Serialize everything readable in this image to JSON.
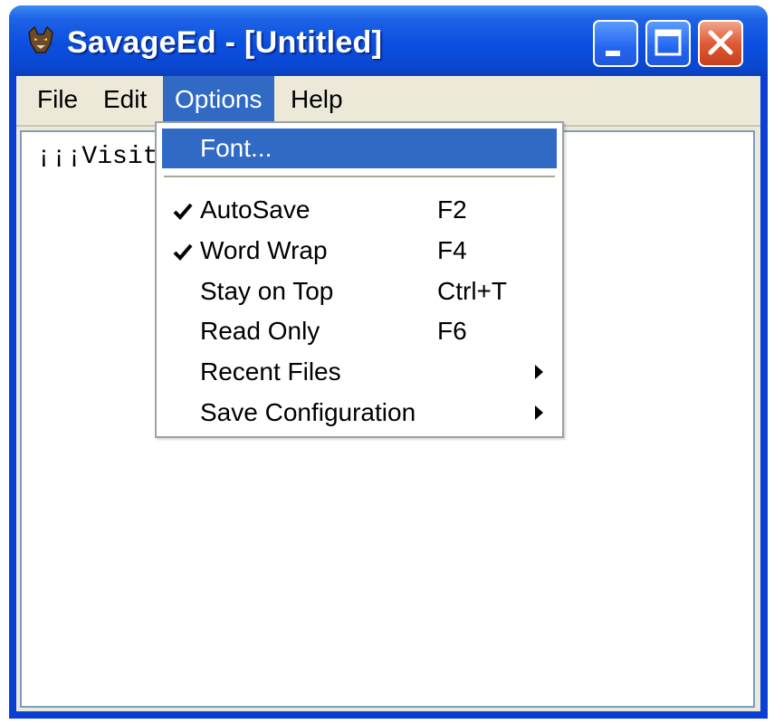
{
  "window": {
    "title": "SavageEd - [Untitled]",
    "icon": "app-icon"
  },
  "titlebar_buttons": {
    "minimize": "minimize-icon",
    "maximize": "maximize-icon",
    "close": "close-icon"
  },
  "menubar": {
    "items": [
      {
        "label": "File"
      },
      {
        "label": "Edit"
      },
      {
        "label": "Options",
        "active": true
      },
      {
        "label": "Help"
      }
    ]
  },
  "editor": {
    "text": "¡¡¡Visit"
  },
  "options_menu": {
    "items": [
      {
        "label": "Font...",
        "shortcut": "",
        "checked": false,
        "submenu": false,
        "highlighted": true
      },
      {
        "separator": true
      },
      {
        "label": "AutoSave",
        "shortcut": "F2",
        "checked": true,
        "submenu": false
      },
      {
        "label": "Word Wrap",
        "shortcut": "F4",
        "checked": true,
        "submenu": false
      },
      {
        "label": "Stay on Top",
        "shortcut": "Ctrl+T",
        "checked": false,
        "submenu": false
      },
      {
        "label": "Read Only",
        "shortcut": "F6",
        "checked": false,
        "submenu": false
      },
      {
        "label": "Recent Files",
        "shortcut": "",
        "checked": false,
        "submenu": true
      },
      {
        "label": "Save Configuration",
        "shortcut": "",
        "checked": false,
        "submenu": true
      }
    ]
  },
  "colors": {
    "titlebar": "#0a48d2",
    "menu_highlight": "#316ac5",
    "close_button": "#e05a36",
    "menubar": "#ece9d8"
  }
}
